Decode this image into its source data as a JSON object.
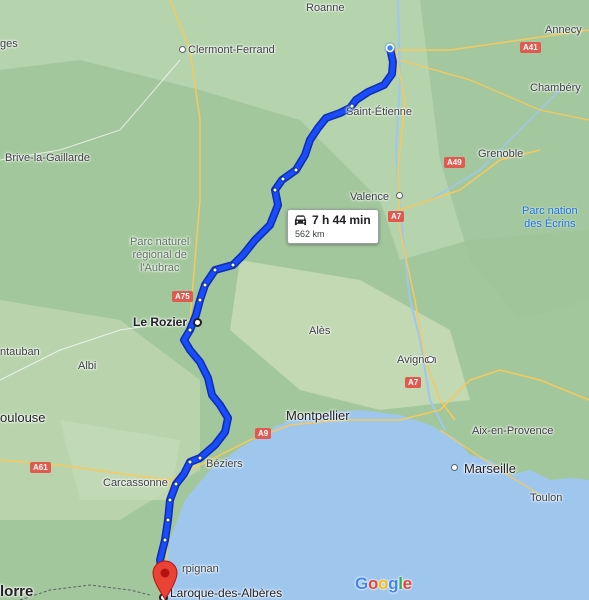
{
  "map": {
    "route": {
      "duration": "7 h 44 min",
      "distance": "562 km"
    },
    "origin": "Le Rozier",
    "destination": "Laroque-des-Albères",
    "cities": {
      "roanne": "Roanne",
      "annecy": "Annecy",
      "clermont": "Clermont-Ferrand",
      "chambery": "Chambéry",
      "saint_etienne": "Saint-Étienne",
      "brive": "Brive-la-Gaillarde",
      "grenoble": "Grenoble",
      "valence": "Valence",
      "ales": "Alès",
      "montauban": "ntauban",
      "avignon": "Avignon",
      "albi": "Albi",
      "montpellier": "Montpellier",
      "toulouse": "oulouse",
      "aix": "Aix-en-Provence",
      "beziers": "Béziers",
      "marseille": "Marseille",
      "carcassonne": "Carcassonne",
      "toulon": "Toulon",
      "perpignan": "rpignan",
      "andorre": "lorre",
      "ges": "ges"
    },
    "parks": {
      "aubrac": "Parc naturel\nrégional de\nl'Aubrac",
      "ecrins": "Parc nation\ndes Écrins"
    },
    "roads": {
      "a41": "A41",
      "a49": "A49",
      "a7a": "A7",
      "a75": "A75",
      "a7b": "A7",
      "a9": "A9",
      "a61": "A61"
    },
    "attribution": {
      "letters": [
        "G",
        "o",
        "o",
        "g",
        "l",
        "e"
      ],
      "colors": [
        "#4285F4",
        "#EA4335",
        "#FBBC05",
        "#4285F4",
        "#34A853",
        "#EA4335"
      ]
    },
    "colors": {
      "route": "#1a4bff",
      "route_outline": "#0d2fa8",
      "water": "#9fc7ee",
      "land": "#a9c9a4",
      "pin": "#ea4335"
    }
  }
}
